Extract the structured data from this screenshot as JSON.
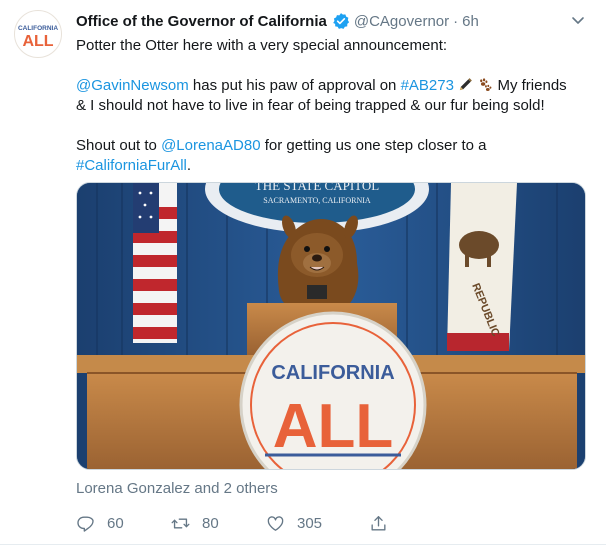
{
  "account": {
    "name": "Office of the Governor of California",
    "handle": "@CAgovernor",
    "separator": "·",
    "time": "6h",
    "avatar_logo_top": "CALIFORNIA",
    "avatar_logo_bottom": "ALL"
  },
  "tweet": {
    "line1": "Potter the Otter here with a very special announcement:",
    "mention_newsom": "@GavinNewsom",
    "text_mid1": " has put his paw of approval on ",
    "hashtag_ab273": "#AB273",
    "text_mid2": " My friends",
    "line3": "& I should not have to live in fear of being trapped & our fur being sold!",
    "text_shout": "Shout out to ",
    "mention_lorena": "@LorenaAD80",
    "text_closer": " for getting us one step closer to a",
    "hashtag_furall": "#CaliforniaFurAll",
    "text_end": "."
  },
  "media": {
    "seal_text_top": "THE STATE CAPITOL",
    "seal_text_bottom": "SACRAMENTO, CALIFORNIA",
    "podium_top": "CALIFORNIA",
    "podium_bottom": "ALL",
    "flag_text": "REPUBLIC"
  },
  "tagged": "Lorena Gonzalez and 2 others",
  "actions": {
    "replies": "60",
    "retweets": "80",
    "likes": "305"
  },
  "colors": {
    "link": "#1b95e0",
    "secondary_text": "#657786",
    "brand_orange": "#e8623a",
    "brand_blue": "#3b5c9a",
    "verified": "#1da1f2"
  },
  "icons": [
    "verified-badge-icon",
    "chevron-down-icon",
    "pen-emoji-icon",
    "paw-prints-emoji-icon",
    "reply-icon",
    "retweet-icon",
    "like-icon",
    "share-icon"
  ]
}
